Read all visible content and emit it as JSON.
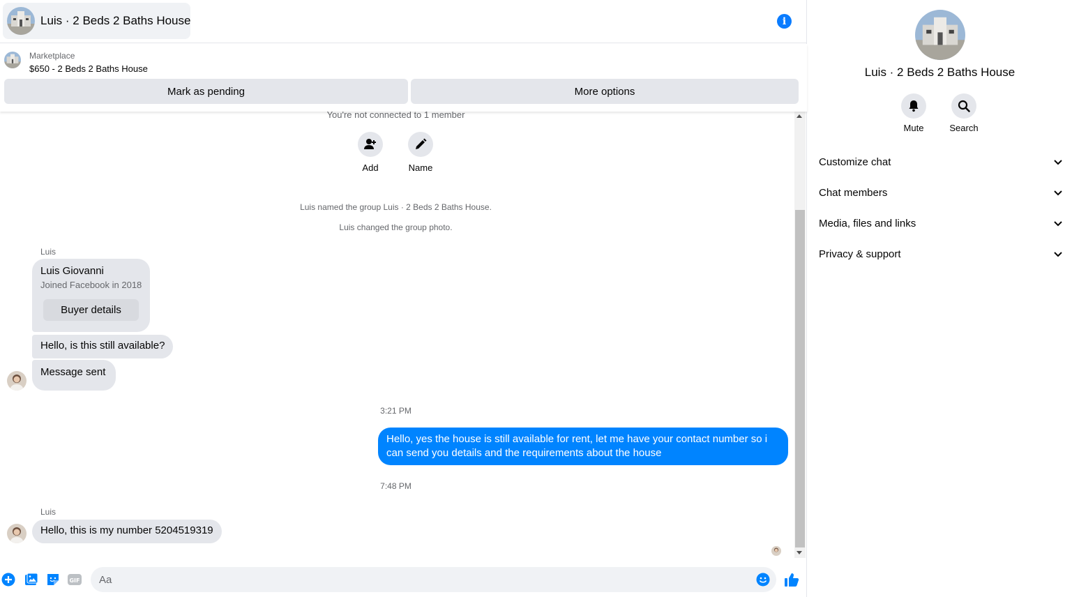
{
  "header": {
    "title": "Luis · 2 Beds 2 Baths House",
    "info_icon": "info-icon"
  },
  "marketplace": {
    "label": "Marketplace",
    "item": "$650 - 2 Beds 2 Baths House",
    "mark_pending": "Mark as pending",
    "more_options": "More options"
  },
  "thread": {
    "not_connected": "You're not connected to 1 member",
    "actions": [
      {
        "label": "Add",
        "icon": "add-person-icon"
      },
      {
        "label": "Name",
        "icon": "pencil-icon"
      }
    ],
    "system_notes": [
      "Luis named the group Luis · 2 Beds 2 Baths House.",
      "Luis changed the group photo."
    ],
    "sender_1": "Luis",
    "profile_card": {
      "name": "Luis Giovanni",
      "subtitle": "Joined Facebook in 2018",
      "button": "Buyer details"
    },
    "msg_1": "Hello, is this still available?",
    "msg_2": "Message sent",
    "time_1": "3:21 PM",
    "msg_out": "Hello, yes the house is still available for rent, let me have your contact number so i can send you details and the requirements about the house",
    "time_2": "7:48 PM",
    "sender_2": "Luis",
    "msg_3": "Hello, this is my number 5204519319"
  },
  "composer": {
    "placeholder": "Aa",
    "icons": [
      "plus-icon",
      "image-icon",
      "sticker-icon",
      "gif-icon",
      "emoji-icon",
      "like-icon"
    ]
  },
  "info_pane": {
    "title": "Luis · 2 Beds 2 Baths House",
    "mute": "Mute",
    "search": "Search",
    "sections": [
      "Customize chat",
      "Chat members",
      "Media, files and links",
      "Privacy & support"
    ]
  },
  "colors": {
    "accent": "#0084ff",
    "bubble_in": "#e4e6eb",
    "secondary_text": "#65676b"
  }
}
